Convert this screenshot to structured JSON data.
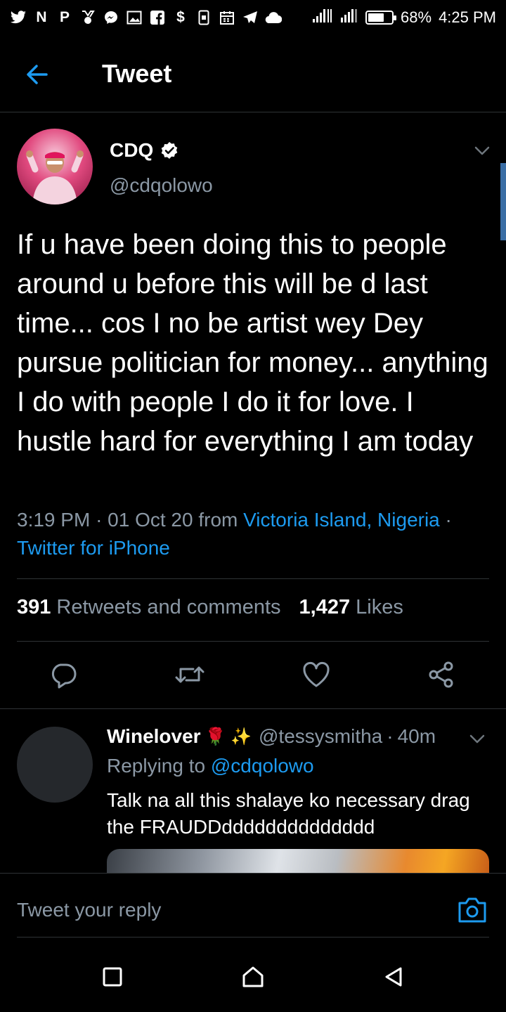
{
  "status_bar": {
    "left_icons": [
      "twitter-icon",
      "nairaland-icon",
      "pinterest-icon",
      "medal-icon",
      "messenger-icon",
      "gallery-icon",
      "facebook-icon",
      "money-icon",
      "sim-icon",
      "calendar-icon",
      "telegram-icon",
      "cloud-icon"
    ],
    "battery_percent": 68,
    "battery_text": "68%",
    "time": "4:25 PM"
  },
  "header": {
    "title": "Tweet"
  },
  "tweet": {
    "author_name": "CDQ",
    "handle": "@cdqolowo",
    "text": "If u have been doing this to people around u before this will be d last time... cos I no be artist wey Dey pursue politician for money... anything I do with people I do it for love. I hustle hard for everything I am today",
    "time": "3:19 PM",
    "separator": "·",
    "date": "01 Oct 20",
    "from_label": "from",
    "location": "Victoria Island, Nigeria",
    "source": "Twitter for iPhone",
    "retweets_count": "391",
    "retweets_label": "Retweets and comments",
    "likes_count": "1,427",
    "likes_label": "Likes"
  },
  "reply": {
    "name": "Winelover",
    "emojis": "🌹 ✨",
    "handle": "@tessysmitha",
    "separator": "·",
    "age": "40m",
    "replying_label": "Replying to",
    "replying_to": "@cdqolowo",
    "text": "Talk na all this shalaye ko necessary drag the FRAUDDdddddddddddddd"
  },
  "composer": {
    "placeholder": "Tweet your reply"
  },
  "colors": {
    "accent": "#1d9bf0",
    "muted": "#8b98a5",
    "background": "#000000",
    "divider": "#2f3336"
  }
}
